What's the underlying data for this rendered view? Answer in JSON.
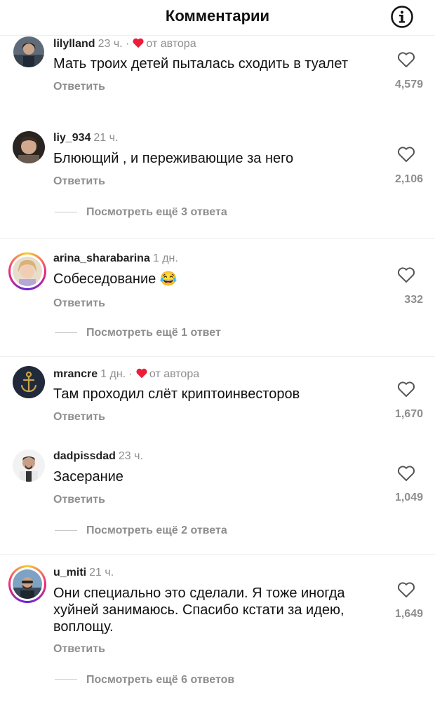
{
  "header": {
    "title": "Комментарии"
  },
  "comments": [
    {
      "username": "lilylland",
      "time": "23 ч.",
      "author_liked": true,
      "author_label": "от автора",
      "text": "Мать троих детей пыталась сходить в туалет",
      "reply": "Ответить",
      "likes": "4,579"
    },
    {
      "username": "liy_934",
      "time": "21 ч.",
      "author_liked": false,
      "text": "Блюющий , и переживающие за него",
      "reply": "Ответить",
      "likes": "2,106",
      "more": "Посмотреть ещё 3 ответа"
    },
    {
      "username": "arina_sharabarina",
      "time": "1 дн.",
      "author_liked": false,
      "text": "Собеседование 😂",
      "reply": "Ответить",
      "likes": "332",
      "more": "Посмотреть ещё 1 ответ"
    },
    {
      "username": "mrancre",
      "time": "1 дн.",
      "author_liked": true,
      "author_label": "от автора",
      "text": "Там проходил слёт криптоинвесторов",
      "reply": "Ответить",
      "likes": "1,670"
    },
    {
      "username": "dadpissdad",
      "time": "23 ч.",
      "author_liked": false,
      "text": "Засерание",
      "reply": "Ответить",
      "likes": "1,049",
      "more": "Посмотреть ещё 2 ответа"
    },
    {
      "username": "u_miti",
      "time": "21 ч.",
      "author_liked": false,
      "text": "Они специально это сделали. Я тоже иногда хуйней занимаюсь. Спасибо кстати за идею, воплощу.",
      "reply": "Ответить",
      "likes": "1,649",
      "more": "Посмотреть ещё 6 ответов"
    }
  ],
  "colors": {
    "heart": "#ed1c3a",
    "muted": "#8e8e8e"
  }
}
